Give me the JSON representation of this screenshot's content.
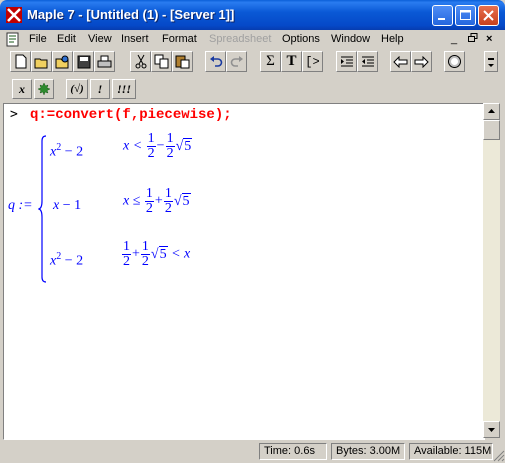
{
  "window": {
    "title": "Maple 7  - [Untitled (1) - [Server 1]]"
  },
  "menu": [
    "File",
    "Edit",
    "View",
    "Insert",
    "Format",
    "Spreadsheet",
    "Options",
    "Window",
    "Help"
  ],
  "menu_disabled": [
    "Spreadsheet"
  ],
  "toolbar": {
    "icons": [
      "new-icon",
      "open-icon",
      "open-url-icon",
      "save-icon",
      "print-icon",
      "cut-icon",
      "copy-icon",
      "paste-icon",
      "undo-icon",
      "redo-icon",
      "sigma-icon",
      "text-icon",
      "prompt-icon",
      "indent-icon",
      "outdent-icon",
      "back-icon",
      "forward-icon",
      "stop-icon"
    ],
    "sigma": "Σ",
    "text": "T",
    "prompt": "[>"
  },
  "toolbar2": {
    "x_label": "x",
    "check_label": "(√)",
    "exclaim_label": "!",
    "triple_exclaim_label": "!!!"
  },
  "worksheet": {
    "prompt": ">",
    "input": "q:=convert(f,piecewise);",
    "output": {
      "lhs": "q :=",
      "rows": [
        {
          "expr_base": "x",
          "expr_exp": "2",
          "expr_rest": " − 2",
          "cond_pre": "x <",
          "frac_num": "1",
          "frac_den": "2",
          "op": "−",
          "frac2_num": "1",
          "frac2_den": "2",
          "sqrt_arg": "5",
          "cond_post": ""
        },
        {
          "expr_base": "x",
          "expr_exp": "",
          "expr_rest": " − 1",
          "cond_pre": "x ≤",
          "frac_num": "1",
          "frac_den": "2",
          "op": "+",
          "frac2_num": "1",
          "frac2_den": "2",
          "sqrt_arg": "5",
          "cond_post": ""
        },
        {
          "expr_base": "x",
          "expr_exp": "2",
          "expr_rest": " − 2",
          "cond_pre": "",
          "frac_num": "1",
          "frac_den": "2",
          "op": "+",
          "frac2_num": "1",
          "frac2_den": "2",
          "sqrt_arg": "5",
          "cond_post": "< x"
        }
      ]
    }
  },
  "status": {
    "time": "Time:  0.6s",
    "bytes": "Bytes: 3.00M",
    "available": "Available: 115M"
  }
}
